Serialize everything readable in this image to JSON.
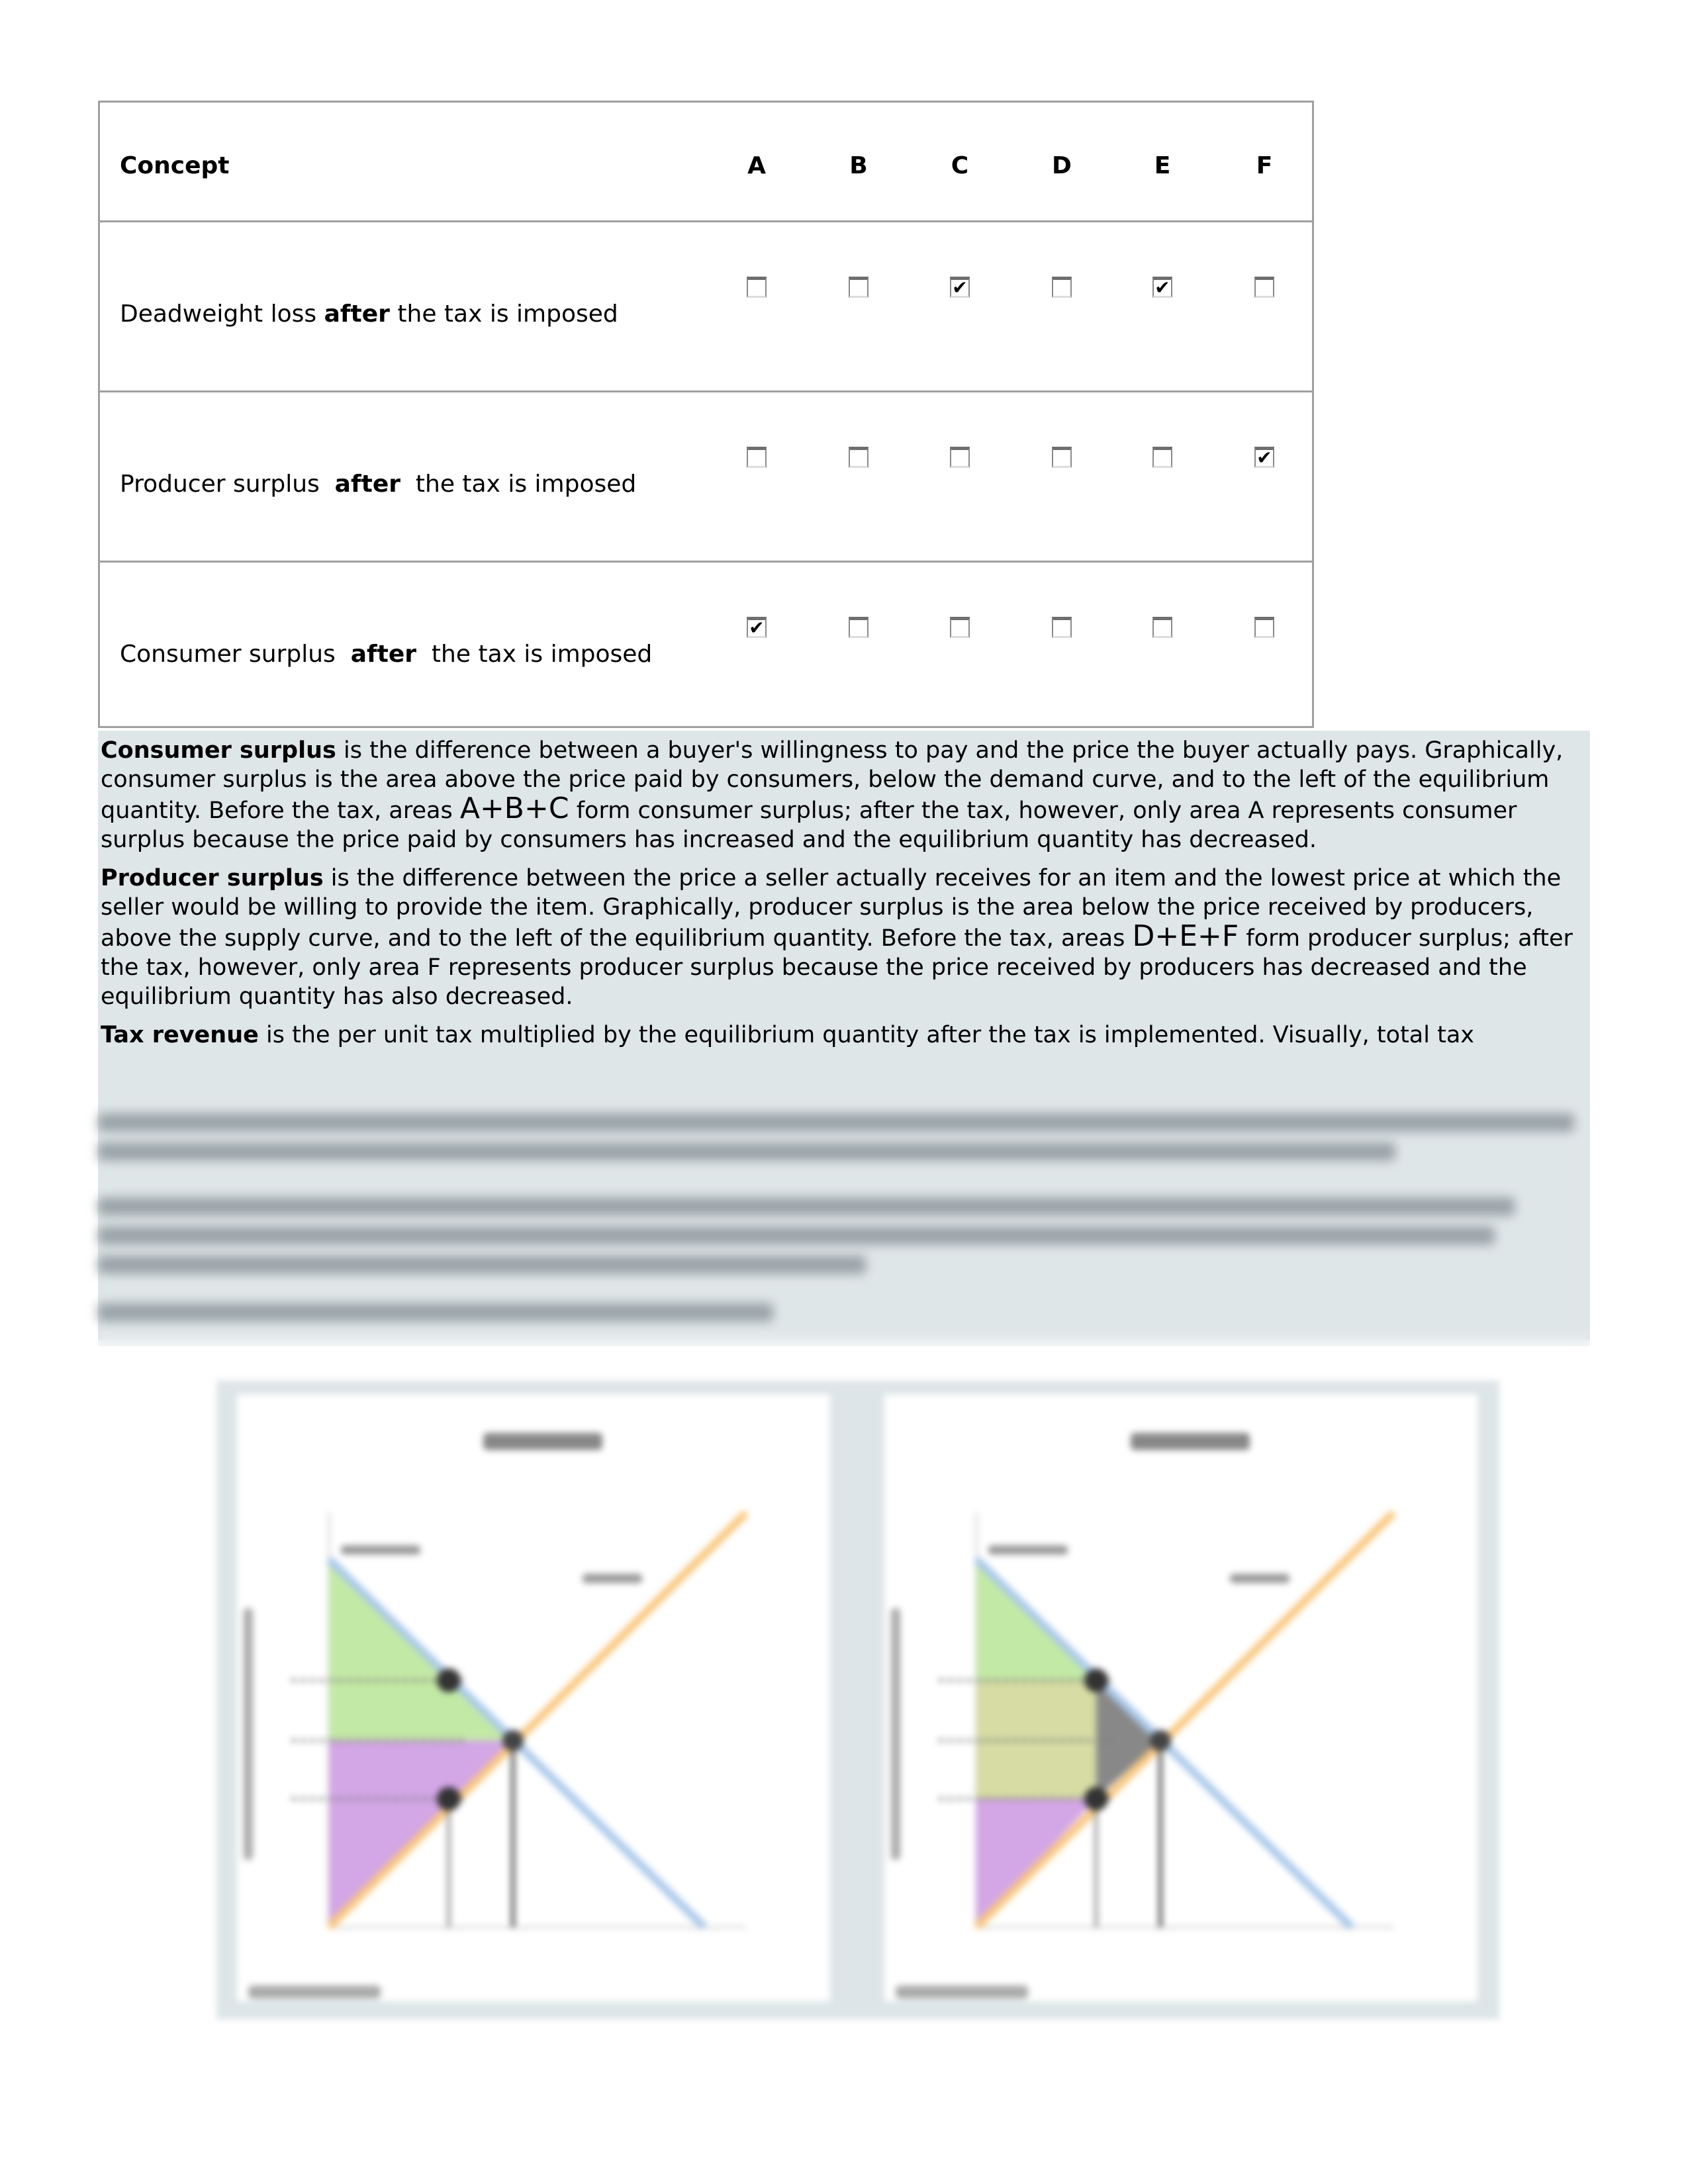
{
  "table": {
    "header": {
      "concept": "Concept",
      "columns": [
        "A",
        "B",
        "C",
        "D",
        "E",
        "F"
      ]
    },
    "rows": [
      {
        "pre": "Deadweight loss ",
        "bold": "after",
        "post": " the tax is imposed",
        "checked": [
          false,
          false,
          true,
          false,
          true,
          false
        ]
      },
      {
        "pre": "Producer surplus  ",
        "bold": "after",
        "post": "  the tax is imposed",
        "checked": [
          false,
          false,
          false,
          false,
          false,
          true
        ]
      },
      {
        "pre": "Consumer surplus  ",
        "bold": "after",
        "post": "  the tax is imposed",
        "checked": [
          true,
          false,
          false,
          false,
          false,
          false
        ]
      }
    ]
  },
  "explanation": {
    "p1": {
      "term": "Consumer surplus",
      "text1": " is the difference between a buyer's willingness to pay and the price the buyer actually pays. Graphically, consumer surplus is the area above the price paid by consumers, below the demand curve, and to the left of the equilibrium quantity. Before the tax, areas ",
      "areas": "A+B+C",
      "text2": " form consumer surplus; after the tax, however, only area A represents consumer surplus because the price paid by consumers has increased and the equilibrium quantity has decreased."
    },
    "p2": {
      "term": "Producer surplus",
      "text1": " is the difference between the price a seller actually receives for an item and the lowest price at which the seller would be willing to provide the item. Graphically, producer surplus is the area below the price received by producers, above the supply curve, and to the left of the equilibrium quantity. Before the tax, areas ",
      "areas": "D+E+F",
      "text2": " form producer surplus; after the tax, however, only area F represents producer surplus because the price received by producers has decreased and the equilibrium quantity has also decreased."
    },
    "p3": {
      "term": "Tax revenue",
      "text1": " is the per unit tax multiplied by the equilibrium quantity after the tax is implemented. Visually, total tax"
    }
  },
  "colors": {
    "panel_bg": "#dfe6e8",
    "consumer_surplus": "#c3e9a6",
    "producer_surplus": "#d3a6e6",
    "tax_revenue": "#d6dca4",
    "demand": "#a9c8ea",
    "supply": "#f9c77e"
  }
}
